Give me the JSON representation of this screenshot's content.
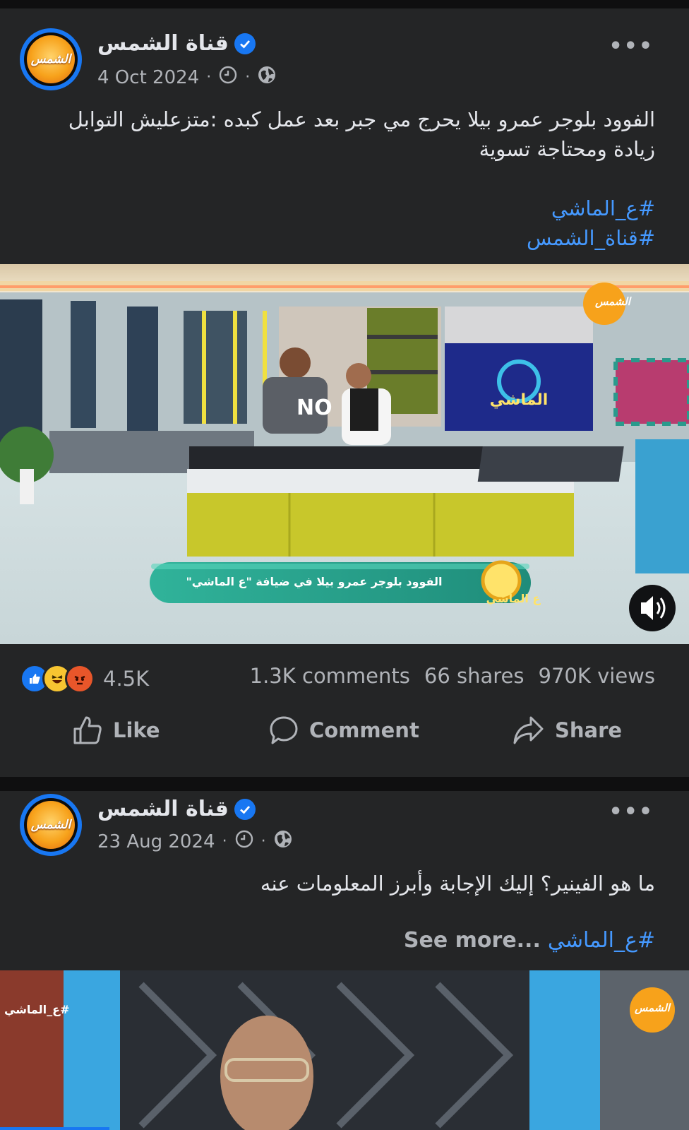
{
  "posts": [
    {
      "page_name": "قناة الشمس",
      "avatar_text": "الشمس",
      "date": "4 Oct 2024",
      "text": "الفوود بلوجر عمرو بيلا يحرج مي جبر بعد عمل كبده :متزعليش التوابل زيادة ومحتاجة تسوية",
      "hashtags": [
        "#ع_الماشي",
        "#قناة_الشمس"
      ],
      "video": {
        "channel_logo": "الشمس",
        "screen_logo": "الماشي",
        "lower_third": "الفوود بلوجر عمرو بيلا في ضيافة \"ع الماشي\"",
        "lower_third_logo": "ع الماشي",
        "shirt_text": "NO"
      },
      "reactions_count": "4.5K",
      "comments": "1.3K comments",
      "shares": "66 shares",
      "views": "970K views",
      "actions": {
        "like": "Like",
        "comment": "Comment",
        "share": "Share"
      }
    },
    {
      "page_name": "قناة الشمس",
      "avatar_text": "الشمس",
      "date": "23 Aug 2024",
      "text": "ما هو الفينير؟ إليك الإجابة وأبرز المعلومات عنه",
      "hashtag": "#ع_الماشي",
      "see_more": "See more...",
      "video": {
        "channel_logo": "الشمس",
        "tag": "#ع_الماشي"
      }
    }
  ],
  "colors": {
    "card": "#242526",
    "link": "#4599ff",
    "verified": "#1877f2",
    "secondary_text": "#b0b3b8"
  }
}
